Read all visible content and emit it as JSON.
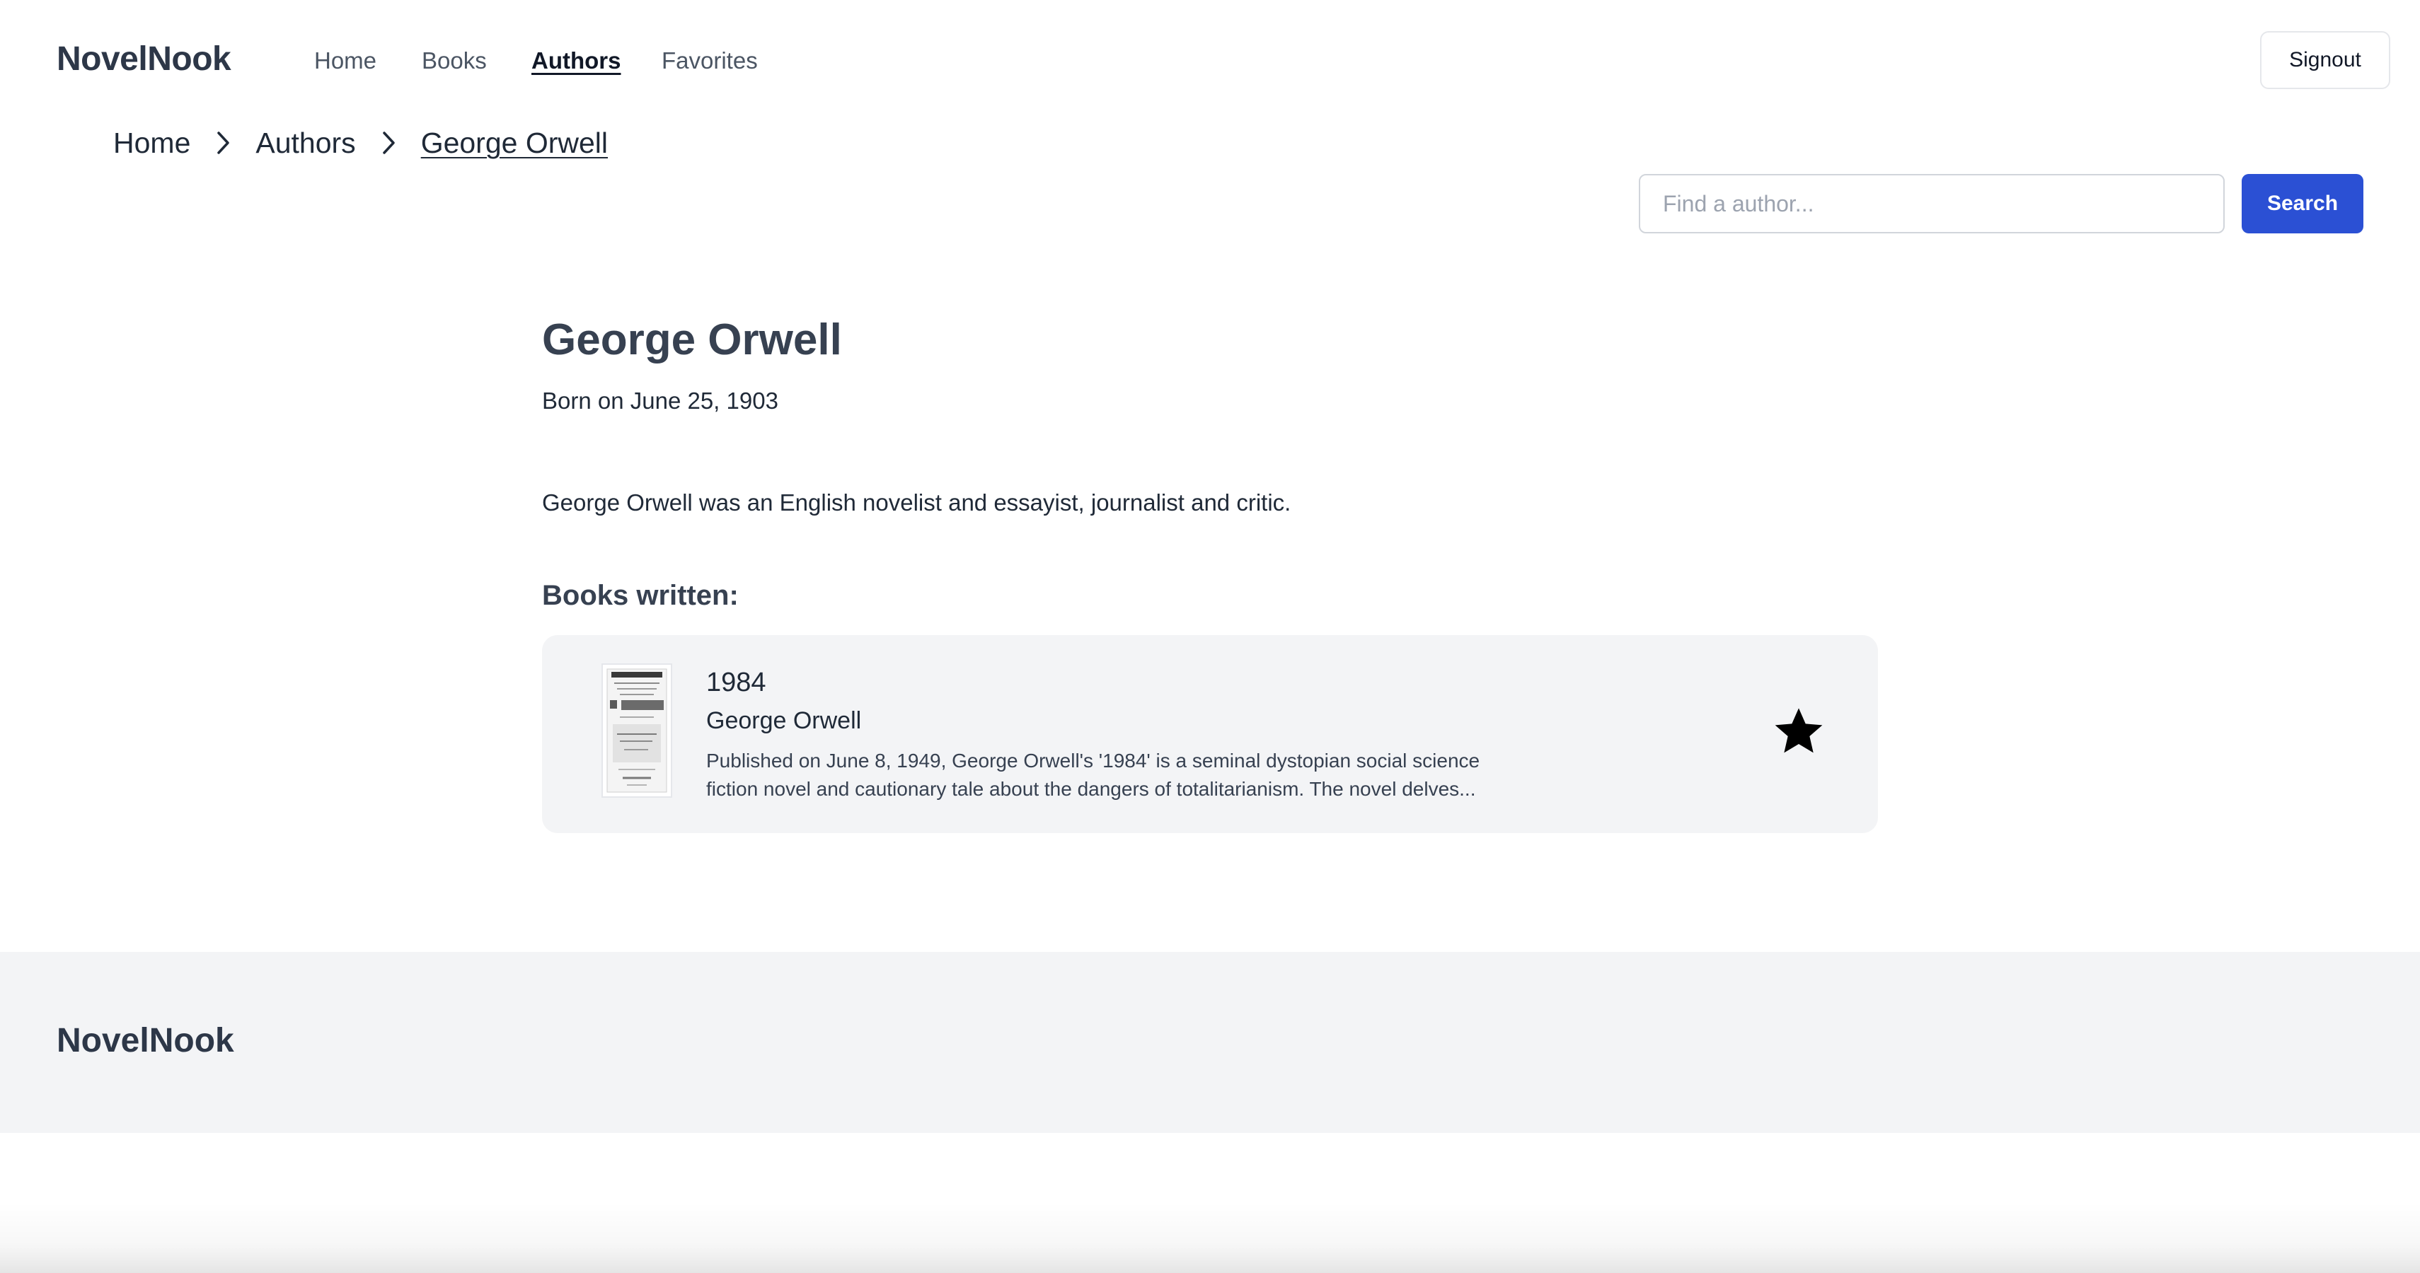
{
  "header": {
    "brand": "NovelNook",
    "nav": [
      {
        "label": "Home",
        "active": false
      },
      {
        "label": "Books",
        "active": false
      },
      {
        "label": "Authors",
        "active": true
      },
      {
        "label": "Favorites",
        "active": false
      }
    ],
    "signout_label": "Signout"
  },
  "breadcrumb": {
    "items": [
      "Home",
      "Authors",
      "George Orwell"
    ]
  },
  "search": {
    "placeholder": "Find a author...",
    "value": "",
    "button_label": "Search"
  },
  "author": {
    "name": "George Orwell",
    "born": "Born on June 25, 1903",
    "bio": "George Orwell was an English novelist and essayist, journalist and critic."
  },
  "books_section": {
    "heading": "Books written:",
    "books": [
      {
        "title": "1984",
        "author": "George Orwell",
        "description": "Published on June 8, 1949, George Orwell's '1984' is a seminal dystopian social science fiction novel and cautionary tale about the dangers of totalitarianism. The novel delves...",
        "favorite": true,
        "favorite_icon": "star-filled-icon"
      }
    ]
  },
  "footer": {
    "brand": "NovelNook"
  },
  "colors": {
    "accent": "#2b50d4",
    "card_bg": "#f3f4f6",
    "footer_bg": "#f3f4f6",
    "text_dark": "#374151"
  }
}
